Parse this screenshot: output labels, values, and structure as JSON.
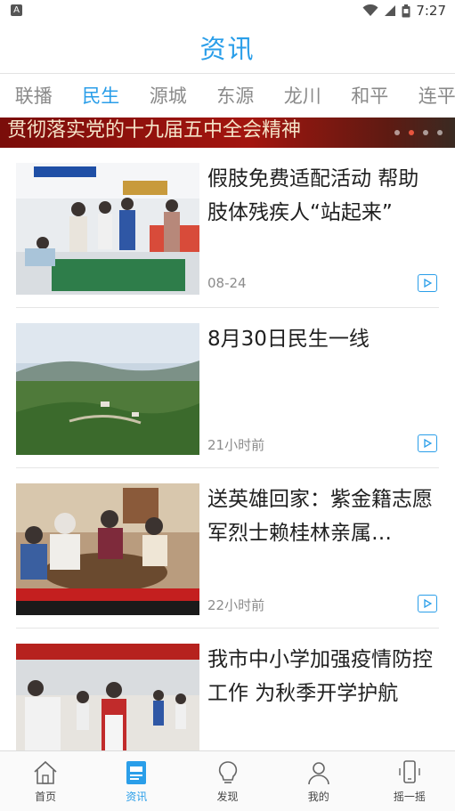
{
  "status": {
    "left_icon": "A",
    "time": "7:27",
    "icons": [
      "wifi-icon",
      "signal-icon",
      "battery-icon"
    ]
  },
  "header": {
    "title": "资讯"
  },
  "tabs": [
    {
      "label": "联播"
    },
    {
      "label": "民生"
    },
    {
      "label": "源城"
    },
    {
      "label": "东源"
    },
    {
      "label": "龙川"
    },
    {
      "label": "和平"
    },
    {
      "label": "连平"
    }
  ],
  "active_tab": "民生",
  "banner": {
    "text": "贯彻落实党的十九届五中全会精神",
    "slides": 4,
    "active_slide": 1
  },
  "news": [
    {
      "title": "假肢免费适配活动  帮助肢体残疾人“站起来”",
      "time": "08-24",
      "icon": "play-icon"
    },
    {
      "title": "8月30日民生一线",
      "time": "21小时前",
      "icon": "play-icon"
    },
    {
      "title": "送英雄回家：紫金籍志愿军烈士赖桂林亲属…",
      "time": "22小时前",
      "icon": "play-icon"
    },
    {
      "title": "我市中小学加强疫情防控工作 为秋季开学护航",
      "time": "",
      "icon": "play-icon"
    }
  ],
  "bottom_nav": [
    {
      "label": "首页",
      "icon": "home-icon"
    },
    {
      "label": "资讯",
      "icon": "news-icon"
    },
    {
      "label": "发现",
      "icon": "bulb-icon"
    },
    {
      "label": "我的",
      "icon": "user-icon"
    },
    {
      "label": "摇一摇",
      "icon": "phone-shake-icon"
    }
  ],
  "colors": {
    "accent": "#2a9ee9",
    "banner": "#a3150f"
  }
}
